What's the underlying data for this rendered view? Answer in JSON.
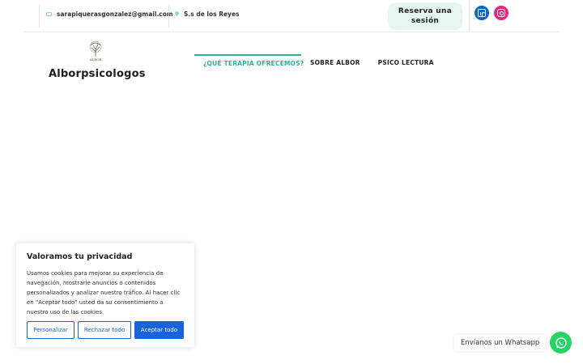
{
  "topbar": {
    "email": "sarapiquerasgonzalez@gmail.com",
    "location": "S.s de los Reyes",
    "reserve_line1": "Reserva una",
    "reserve_line2": "sesión",
    "icons": [
      "mail-icon",
      "location-pin-icon",
      "linkedin-icon",
      "instagram-icon"
    ],
    "linkedin_color": "#0a66c2",
    "instagram_color": "#e4287c"
  },
  "header": {
    "logo_text": "ALBOR",
    "brand": "Alborpsicologos"
  },
  "nav": {
    "items": [
      {
        "label": "¿QUÉ TERAPIA OFRECEMOS?",
        "active": true
      },
      {
        "label": "SOBRE ALBOR"
      },
      {
        "label": "PSICO LECTURA"
      }
    ],
    "accent": "#2bb39a"
  },
  "cookie": {
    "title": "Valoramos tu privacidad",
    "body": "Usamos cookies para mejorar su experiencia de navegación, mostrarle anuncios o contenidos personalizados y analizar nuestro tráfico. Al hacer clic en \"Aceptar todo\" usted da su consentimiento a nuestro uso de las cookies.",
    "customize_label": "Personalizar",
    "reject_label": "Rechazar todo",
    "accept_label": "Aceptar todo",
    "accent": "#1863dc"
  },
  "whatsapp": {
    "label": "Envíanos un Whatsapp",
    "color": "#25d366"
  }
}
